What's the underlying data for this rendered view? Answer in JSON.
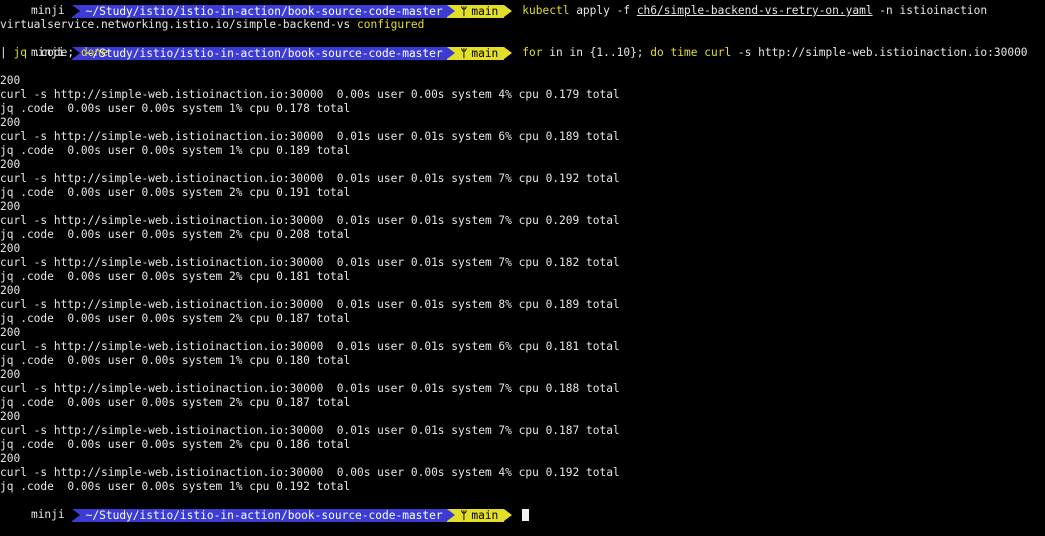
{
  "prompt": {
    "user": "minji",
    "path": "~/Study/istio/istio-in-action/book-source-code-master",
    "branch_icon": "branch-icon",
    "branch": "main"
  },
  "line1": {
    "cmd_kubectl": "kubectl",
    "cmd_rest1": " apply -f ",
    "file": "ch6/simple-backend-vs-retry-on.yaml",
    "cmd_rest2": " -n istioinaction"
  },
  "line2": {
    "resource": "virtualservice.networking.istio.io/simple-backend-vs ",
    "status": "configured"
  },
  "line3": {
    "kw_for": "for",
    "for_rest": " in in {1..10}; ",
    "kw_do": "do",
    "sp1": " ",
    "kw_time": "time",
    "sp2": " ",
    "kw_curl": "curl",
    "curl_rest": " -s http://simple-web.istioinaction.io:30000"
  },
  "line4": {
    "pipe": "| ",
    "kw_jq": "jq",
    "jq_rest": " .code; ",
    "kw_done": "done"
  },
  "output": [
    "200",
    "curl -s http://simple-web.istioinaction.io:30000  0.00s user 0.00s system 4% cpu 0.179 total",
    "jq .code  0.00s user 0.00s system 1% cpu 0.178 total",
    "200",
    "curl -s http://simple-web.istioinaction.io:30000  0.01s user 0.01s system 6% cpu 0.189 total",
    "jq .code  0.00s user 0.00s system 1% cpu 0.189 total",
    "200",
    "curl -s http://simple-web.istioinaction.io:30000  0.01s user 0.01s system 7% cpu 0.192 total",
    "jq .code  0.00s user 0.00s system 2% cpu 0.191 total",
    "200",
    "curl -s http://simple-web.istioinaction.io:30000  0.01s user 0.01s system 7% cpu 0.209 total",
    "jq .code  0.00s user 0.00s system 2% cpu 0.208 total",
    "200",
    "curl -s http://simple-web.istioinaction.io:30000  0.01s user 0.01s system 7% cpu 0.182 total",
    "jq .code  0.00s user 0.00s system 2% cpu 0.181 total",
    "200",
    "curl -s http://simple-web.istioinaction.io:30000  0.01s user 0.01s system 8% cpu 0.189 total",
    "jq .code  0.00s user 0.00s system 2% cpu 0.187 total",
    "200",
    "curl -s http://simple-web.istioinaction.io:30000  0.01s user 0.01s system 6% cpu 0.181 total",
    "jq .code  0.00s user 0.00s system 1% cpu 0.180 total",
    "200",
    "curl -s http://simple-web.istioinaction.io:30000  0.01s user 0.01s system 7% cpu 0.188 total",
    "jq .code  0.00s user 0.00s system 2% cpu 0.187 total",
    "200",
    "curl -s http://simple-web.istioinaction.io:30000  0.01s user 0.01s system 7% cpu 0.187 total",
    "jq .code  0.00s user 0.00s system 2% cpu 0.186 total",
    "200",
    "curl -s http://simple-web.istioinaction.io:30000  0.00s user 0.00s system 4% cpu 0.192 total",
    "jq .code  0.00s user 0.00s system 1% cpu 0.192 total"
  ],
  "colors": {
    "background": "#000000",
    "text": "#e6e6e6",
    "prompt_path_bg": "#3b3bd6",
    "prompt_branch_bg": "#e3de2a",
    "keyword": "#e3de2a"
  }
}
